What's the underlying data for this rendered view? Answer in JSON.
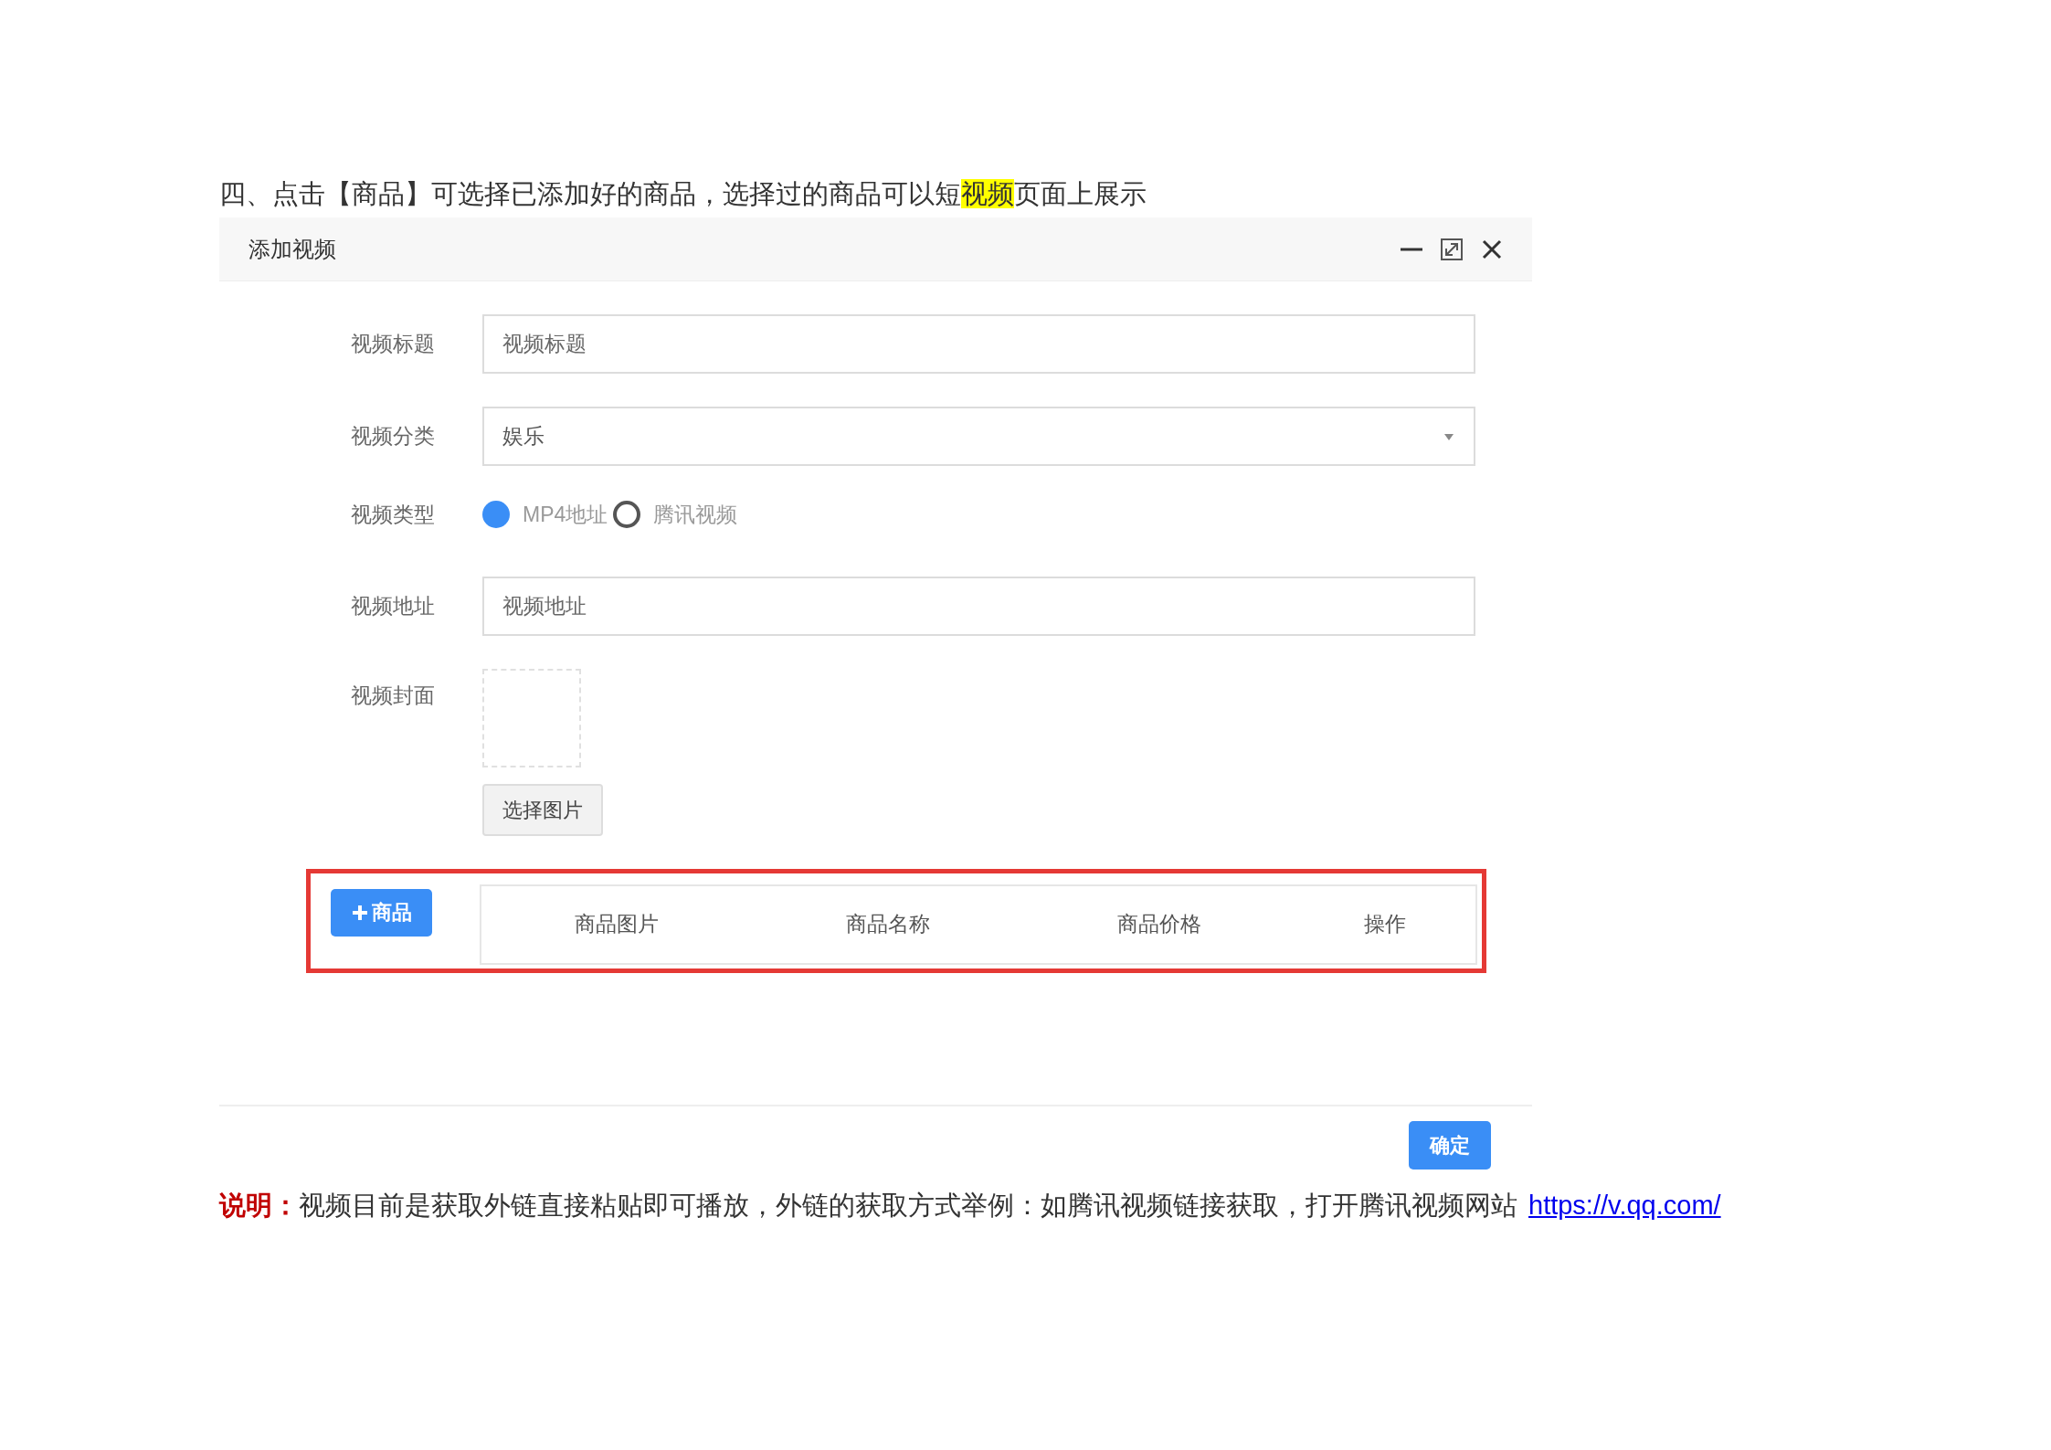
{
  "heading": {
    "parts": [
      {
        "text": "四、点击【商品】可选择已添加好的商品，选择过的商品可以短",
        "highlighted": false
      },
      {
        "text": "视频",
        "highlighted": true
      },
      {
        "text": "页面上展示",
        "highlighted": false
      }
    ]
  },
  "dialog": {
    "title": "添加视频",
    "fields": [
      {
        "kind": "input",
        "label": "视频标题",
        "placeholder": "视频标题"
      },
      {
        "kind": "select",
        "label": "视频分类",
        "value": "娱乐"
      },
      {
        "kind": "radio",
        "label": "视频类型",
        "options": [
          {
            "label": "MP4地址",
            "selected": true
          },
          {
            "label": "腾讯视频",
            "selected": false
          }
        ]
      },
      {
        "kind": "input",
        "label": "视频地址",
        "placeholder": "视频地址"
      },
      {
        "kind": "image",
        "label": "视频封面",
        "button": "选择图片"
      }
    ],
    "goods": {
      "add_button": "商品",
      "columns": [
        "商品图片",
        "商品名称",
        "商品价格",
        "操作"
      ]
    },
    "confirm": "确定"
  },
  "note": {
    "label": "说明：",
    "text": "视频目前是获取外链直接粘贴即可播放，外链的获取方式举例：如腾讯视频链接获取，打开腾讯视频网站",
    "link": "https://v.qq.com/"
  }
}
